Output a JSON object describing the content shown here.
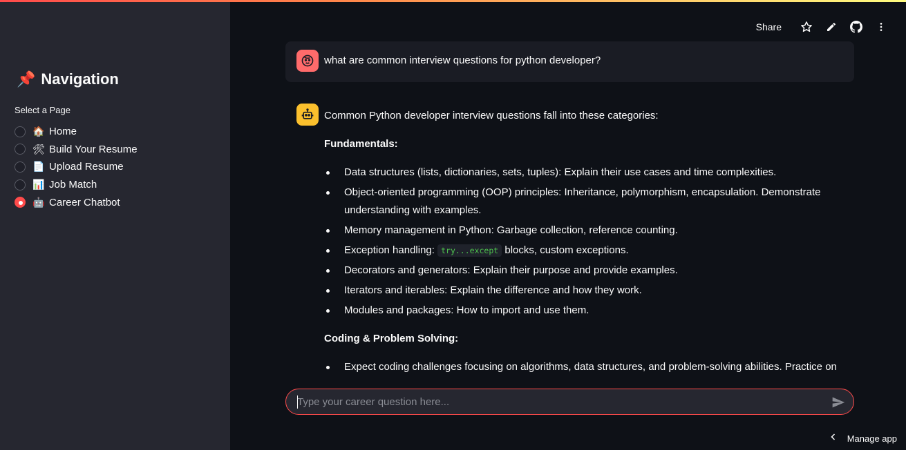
{
  "sidebar": {
    "title_emoji": "📌",
    "title": "Navigation",
    "select_label": "Select a Page",
    "pages": [
      {
        "emoji": "🏠",
        "label": "Home",
        "selected": false
      },
      {
        "emoji": "🛠",
        "label": "Build Your Resume",
        "selected": false
      },
      {
        "emoji": "📄",
        "label": "Upload Resume",
        "selected": false
      },
      {
        "emoji": "📊",
        "label": "Job Match",
        "selected": false
      },
      {
        "emoji": "🤖",
        "label": "Career Chatbot",
        "selected": true
      }
    ]
  },
  "toolbar": {
    "share_label": "Share",
    "icons": [
      "star-icon",
      "pencil-icon",
      "github-icon",
      "more-vertical-icon"
    ]
  },
  "chat": {
    "user_message": "what are common interview questions for python developer?",
    "bot_intro": "Common Python developer interview questions fall into these categories:",
    "section1_heading": "Fundamentals:",
    "section1_items": [
      "Data structures (lists, dictionaries, sets, tuples): Explain their use cases and time complexities.",
      "Object-oriented programming (OOP) principles: Inheritance, polymorphism, encapsulation. Demonstrate understanding with examples.",
      "Memory management in Python: Garbage collection, reference counting.",
      "Exception handling:",
      "Decorators and generators: Explain their purpose and provide examples.",
      "Iterators and iterables: Explain the difference and how they work.",
      "Modules and packages: How to import and use them."
    ],
    "exception_code": "try...except",
    "exception_suffix": " blocks, custom exceptions.",
    "section2_heading": "Coding & Problem Solving:",
    "section2_items": [
      "Expect coding challenges focusing on algorithms, data structures, and problem-solving abilities. Practice on"
    ]
  },
  "input": {
    "placeholder": "Type your career question here..."
  },
  "footer": {
    "manage_app_label": "Manage app"
  },
  "colors": {
    "accent": "#ff4b4b",
    "sidebar_bg": "#262730",
    "main_bg": "#0e1117",
    "user_avatar": "#ff6b6b",
    "bot_avatar": "#fbc02d",
    "code_text": "#4dc14d"
  }
}
